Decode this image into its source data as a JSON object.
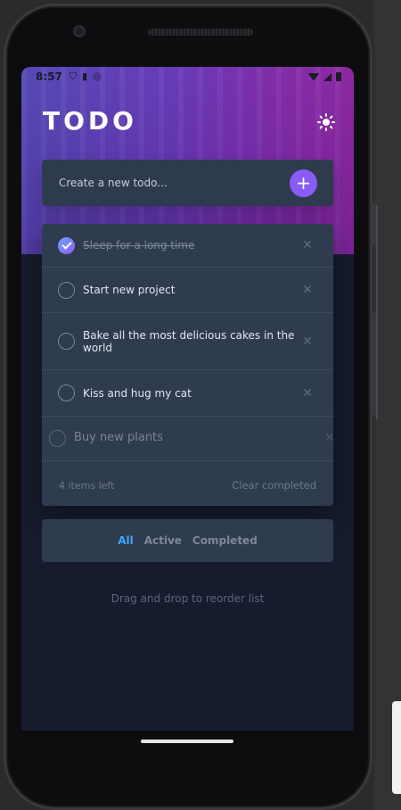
{
  "status": {
    "time": "8:57"
  },
  "app": {
    "title": "TODO"
  },
  "create": {
    "placeholder": "Create a new todo..."
  },
  "todos": [
    {
      "text": "Sleep for a long time",
      "done": true
    },
    {
      "text": "Start new project",
      "done": false
    },
    {
      "text": "Bake all the most delicious cakes in the world",
      "done": false
    },
    {
      "text": "Kiss and hug my cat",
      "done": false
    }
  ],
  "dragging_item": {
    "text": "Buy new plants",
    "done": false
  },
  "footer": {
    "items_left": "4 items left",
    "clear": "Clear completed"
  },
  "filters": {
    "all": "All",
    "active": "Active",
    "completed": "Completed",
    "selected": "All"
  },
  "hint": "Drag and drop to reorder list",
  "colors": {
    "accent": "#3fa7ff",
    "add_button": "#8a5cf6",
    "card": "#2f3c4f",
    "background": "#161c2e"
  },
  "icons": {
    "theme": "sun-icon",
    "add": "plus-icon",
    "delete": "close-icon",
    "check": "checkmark-icon"
  }
}
